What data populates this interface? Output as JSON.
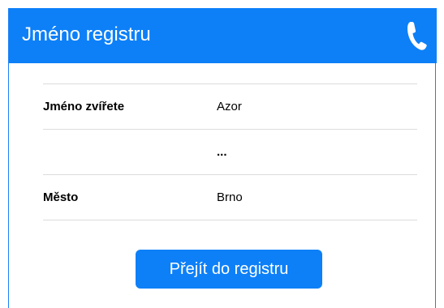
{
  "header": {
    "title": "Jméno registru",
    "phone_icon": "phone-icon"
  },
  "rows": [
    {
      "label": "Jméno zvířete",
      "value": "Azor"
    },
    {
      "label": "",
      "value": "..."
    },
    {
      "label": "Město",
      "value": "Brno"
    }
  ],
  "button": {
    "label": "Přejít do registru"
  },
  "colors": {
    "accent": "#0d80f8",
    "divider": "#dcdcdc"
  }
}
